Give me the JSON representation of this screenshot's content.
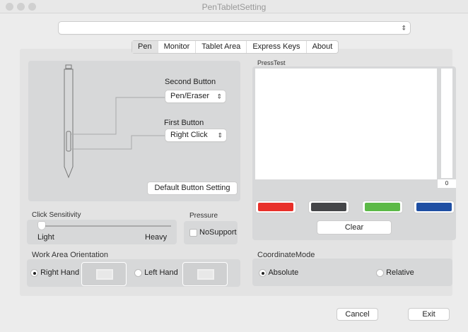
{
  "window": {
    "title": "PenTabletSetting"
  },
  "device_select": {
    "value": ""
  },
  "tabs": [
    {
      "label": "Pen"
    },
    {
      "label": "Monitor"
    },
    {
      "label": "Tablet Area"
    },
    {
      "label": "Express Keys"
    },
    {
      "label": "About"
    }
  ],
  "pen": {
    "second_button_label": "Second Button",
    "second_button_value": "Pen/Eraser",
    "first_button_label": "First Button",
    "first_button_value": "Right Click",
    "default_button": "Default  Button Setting"
  },
  "click_sensitivity": {
    "label": "Click Sensitivity",
    "min_label": "Light",
    "max_label": "Heavy",
    "value": 0
  },
  "pressure": {
    "label": "Pressure",
    "checkbox_label": "NoSupport",
    "checked": false
  },
  "orientation": {
    "label": "Work Area Orientation",
    "options": [
      {
        "label": "Right Hand",
        "selected": true
      },
      {
        "label": "Left Hand",
        "selected": false
      }
    ]
  },
  "press_test": {
    "label": "PressTest",
    "pressure_value": "0",
    "colors": [
      "#e8302a",
      "#444548",
      "#5cb947",
      "#1f4fa3"
    ],
    "clear_label": "Clear"
  },
  "coordinate_mode": {
    "label": "CoordinateMode",
    "options": [
      {
        "label": "Absolute",
        "selected": true
      },
      {
        "label": "Relative",
        "selected": false
      }
    ]
  },
  "footer": {
    "cancel": "Cancel",
    "exit": "Exit"
  }
}
